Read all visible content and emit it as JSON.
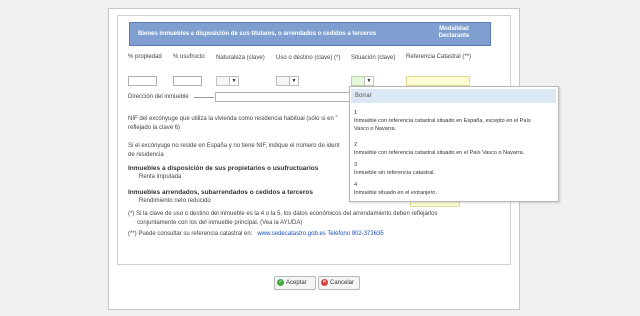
{
  "header": {
    "title": "Bienes inmuebles a disposición de sus titulares, o arrendados o cedidos a terceros",
    "modalidad_line1": "Modalidad",
    "modalidad_line2": "Declarante"
  },
  "columns": {
    "propiedad": "% propiedad",
    "usufructo": "% usufructo",
    "naturaleza": "Naturaleza (clave)",
    "uso": "Uso o destino (clave) (*)",
    "situacion": "Situación (clave)",
    "referencia": "Referencia Catastral (**)"
  },
  "direccion_label": "Dirección del inmueble",
  "nif_text_1": "NIF del excónyuge que utiliza la vivienda como residencia habitual (sólo si en \"",
  "nif_text_2": "reflejado la clave 6)",
  "no_reside_text_1": "Si el excónyuge no reside en España y no tiene NIF, indique el número de ident",
  "no_reside_text_2": "de residencia",
  "sec1_title": "Inmuebles a disposición de sus propietarios o usufructuarios",
  "sec1_sub": "Renta imputada",
  "sec2_title": "Inmuebles arrendados, subarrendados o cedidos a terceros",
  "sec2_sub": "Rendimiento neto reducido",
  "note1_line1": "(*) Si la clave de uso o destino del inmueble es la 4 o la 5, los datos económicos del arrendamiento deben reflejarlos",
  "note1_line2": "conjuntamente con los del inmueble principal. (Vea la AYUDA)",
  "note2_prefix": "(**) Puede consultar su referencia catastral en:",
  "note2_link": "www.sedecatastro.gob.es",
  "note2_phone": "Teléfono 902-373635",
  "dropdown": {
    "clear_label": "Borrar",
    "options": [
      {
        "code": "1",
        "text_1": "Inmueble con referencia catastral situado en España, excepto en el País",
        "text_2": "Vasco o Navarra."
      },
      {
        "code": "2",
        "text_1": "Inmueble con referencia catastral situado en el País Vasco o Navarra.",
        "text_2": ""
      },
      {
        "code": "3",
        "text_1": "Inmueble sin referencia catastral.",
        "text_2": ""
      },
      {
        "code": "4",
        "text_1": "Inmueble situado en el extranjero.",
        "text_2": ""
      }
    ]
  },
  "buttons": {
    "accept": "Aceptar",
    "cancel": "Cancelar",
    "accept_color": "#3fa93f",
    "cancel_color": "#d84040"
  }
}
